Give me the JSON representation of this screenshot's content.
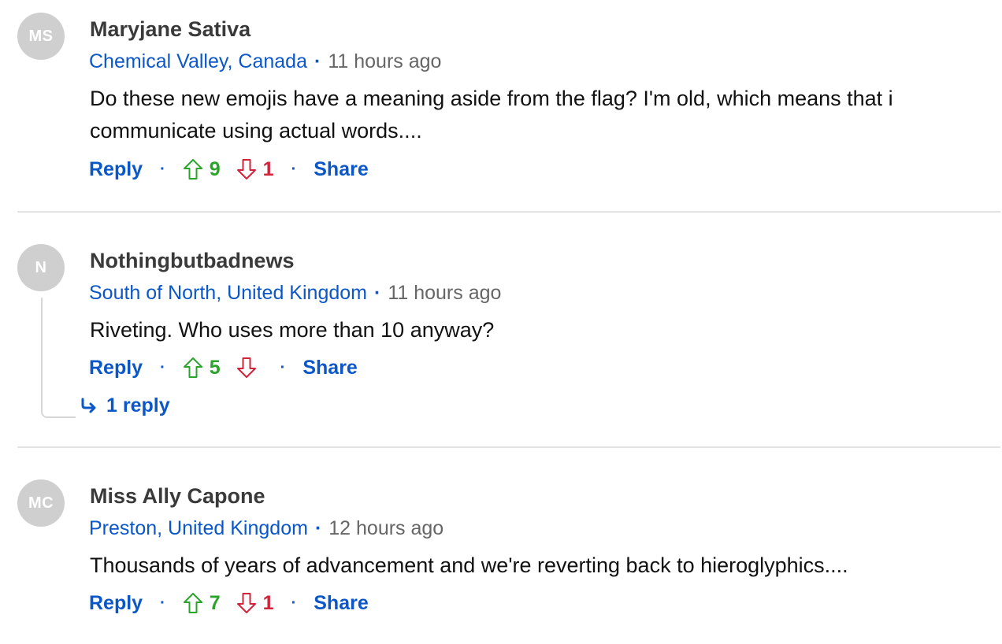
{
  "colors": {
    "link": "#0b57c8",
    "upvote": "#2aa52a",
    "downvote": "#d1243b",
    "avatar_bg": "#cfcfcf",
    "meta_gray": "#666666"
  },
  "comments": [
    {
      "initials": "MS",
      "author": "Maryjane Sativa",
      "location": "Chemical Valley, Canada",
      "time": "11 hours ago",
      "text": "Do these new emojis have a meaning aside from the flag? I'm old, which means that i communicate using actual words....",
      "reply_label": "Reply",
      "upvotes": "9",
      "downvotes": "1",
      "share_label": "Share"
    },
    {
      "initials": "N",
      "author": "Nothingbutbadnews",
      "location": "South of North, United Kingdom",
      "time": "11 hours ago",
      "text": "Riveting. Who uses more than 10 anyway?",
      "reply_label": "Reply",
      "upvotes": "5",
      "downvotes": "",
      "share_label": "Share",
      "replies_label": "1 reply"
    },
    {
      "initials": "MC",
      "author": "Miss Ally Capone",
      "location": "Preston, United Kingdom",
      "time": "12 hours ago",
      "text": "Thousands of years of advancement and we're reverting back to hieroglyphics....",
      "reply_label": "Reply",
      "upvotes": "7",
      "downvotes": "1",
      "share_label": "Share"
    }
  ],
  "icons": {
    "upvote": "arrow-up-outline",
    "downvote": "arrow-down-outline",
    "reply_thread": "curved-arrow-right"
  }
}
